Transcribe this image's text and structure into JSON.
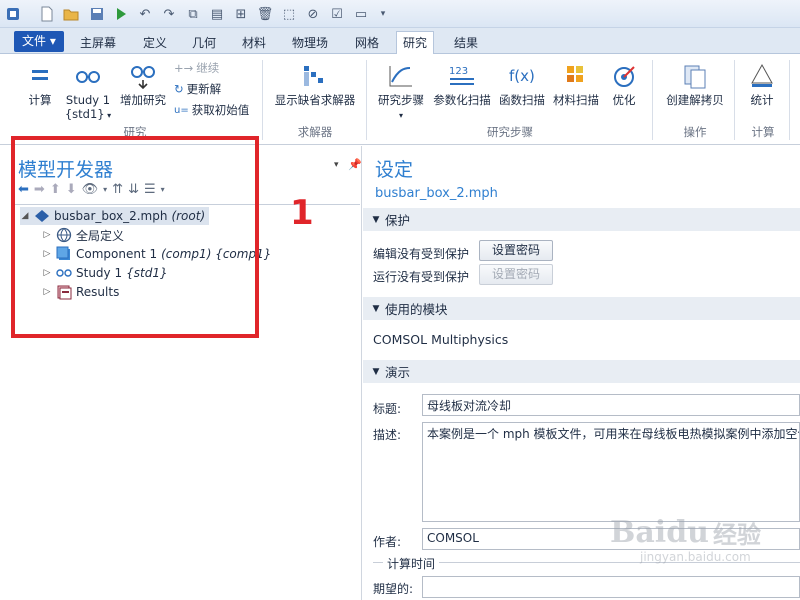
{
  "tabs": {
    "file": "文件 ▾",
    "items": [
      "主屏幕",
      "定义",
      "几何",
      "材料",
      "物理场",
      "网格",
      "研究",
      "结果"
    ],
    "active": "研究"
  },
  "ribbon": {
    "compute": "计算",
    "study1": "Study 1",
    "study1_sub": "{std1}",
    "add_study": "增加研究",
    "continue": "继续",
    "update": "更新解",
    "get_initial": "获取初始值",
    "group_study": "研究",
    "show_default_solver": "显示缺省求解器",
    "group_solver": "求解器",
    "study_steps": "研究步骤",
    "param_sweep": "参数化扫描",
    "func_sweep": "函数扫描",
    "mat_sweep": "材料扫描",
    "optimization": "优化",
    "group_steps": "研究步骤",
    "create_solution_copy": "创建解拷贝",
    "group_operation": "操作",
    "stats": "统计",
    "group_compute": "计算"
  },
  "left": {
    "title": "模型开发器",
    "tree": {
      "root_name": "busbar_box_2.mph",
      "root_tag": "(root)",
      "items": [
        {
          "label": "全局定义",
          "tag": ""
        },
        {
          "label": "Component 1",
          "tag": "(comp1) {comp1}"
        },
        {
          "label": "Study 1",
          "tag": "{std1}"
        },
        {
          "label": "Results",
          "tag": ""
        }
      ]
    }
  },
  "right": {
    "title": "设定",
    "subtitle": "busbar_box_2.mph",
    "protect": {
      "header": "保护",
      "edit_label": "编辑没有受到保护",
      "run_label": "运行没有受到保护",
      "set_password": "设置密码"
    },
    "modules": {
      "header": "使用的模块",
      "value": "COMSOL Multiphysics"
    },
    "presentation": {
      "header": "演示",
      "title_label": "标题:",
      "title_value": "母线板对流冷却",
      "desc_label": "描述:",
      "desc_value": "本案例是一个 mph 模板文件，可用来在母线板电热模拟案例中添加空气",
      "author_label": "作者:",
      "author_value": "COMSOL",
      "calc_time_header": "计算时间",
      "expected_label": "期望的:"
    }
  },
  "annotation": {
    "number": "1"
  },
  "watermark": {
    "brand": "Baidu",
    "sub": "经验",
    "url": "jingyan.baidu.com"
  }
}
